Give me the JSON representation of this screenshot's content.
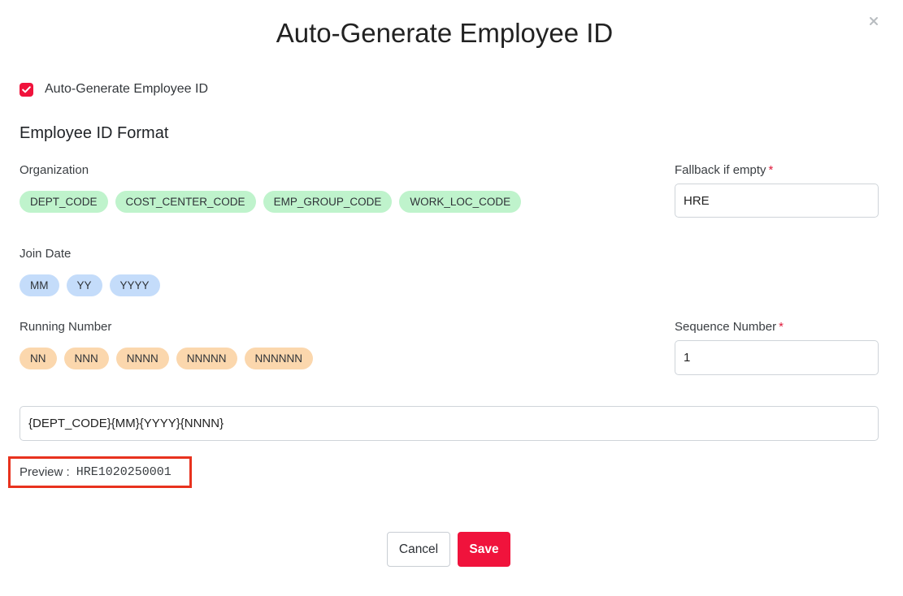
{
  "dialog": {
    "title": "Auto-Generate Employee ID",
    "close_icon": "close-icon"
  },
  "auto_generate": {
    "checked": true,
    "label": "Auto-Generate Employee ID"
  },
  "format": {
    "section_title": "Employee ID Format",
    "organization": {
      "label": "Organization",
      "chips": [
        "DEPT_CODE",
        "COST_CENTER_CODE",
        "EMP_GROUP_CODE",
        "WORK_LOC_CODE"
      ]
    },
    "join_date": {
      "label": "Join Date",
      "chips": [
        "MM",
        "YY",
        "YYYY"
      ]
    },
    "running_number": {
      "label": "Running Number",
      "chips": [
        "NN",
        "NNN",
        "NNNN",
        "NNNNN",
        "NNNNNN"
      ]
    },
    "fallback": {
      "label": "Fallback if empty",
      "required_mark": "*",
      "value": "HRE"
    },
    "sequence": {
      "label": "Sequence Number",
      "required_mark": "*",
      "value": "1"
    },
    "pattern": {
      "value": "{DEPT_CODE}{MM}{YYYY}{NNNN}"
    }
  },
  "preview": {
    "label": "Preview :",
    "value": "HRE1020250001"
  },
  "actions": {
    "cancel_label": "Cancel",
    "save_label": "Save"
  },
  "colors": {
    "accent": "#f0133c",
    "org_chip": "#bff3cc",
    "date_chip": "#c4dcfa",
    "number_chip": "#fbd7ad",
    "highlight_border": "#e8321e"
  }
}
